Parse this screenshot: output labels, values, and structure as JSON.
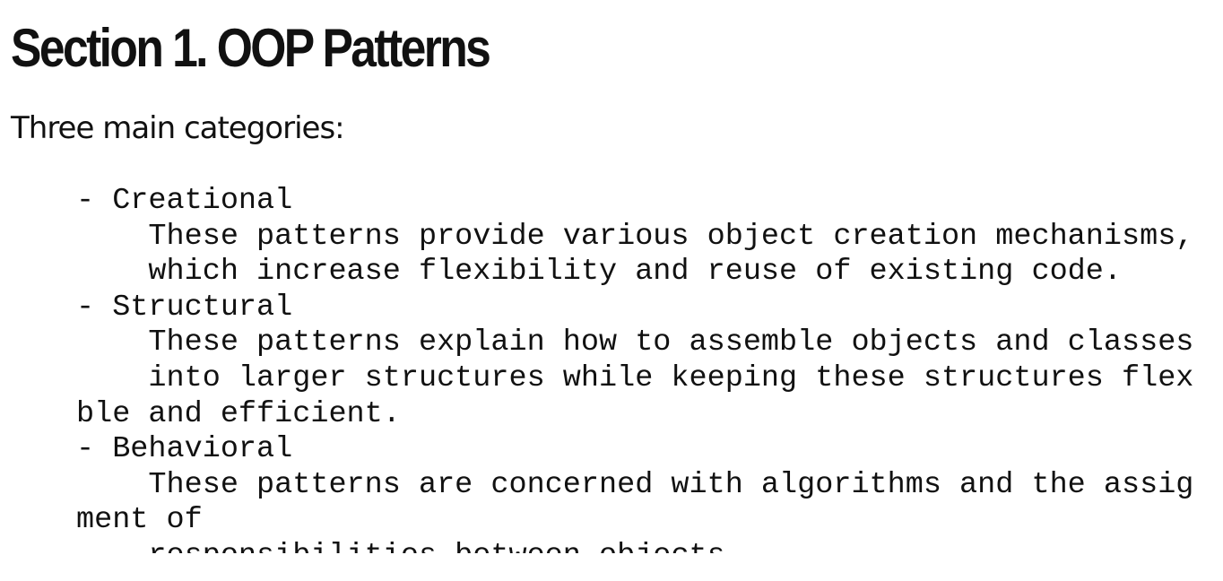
{
  "slide": {
    "title": "Section 1. OOP Patterns",
    "subtitle": "Three main categories:"
  },
  "code_block": {
    "lines": [
      "- Creational",
      "    These patterns provide various object creation mechanisms,",
      "    which increase flexibility and reuse of existing code.",
      "- Structural",
      "    These patterns explain how to assemble objects and classes",
      "    into larger structures while keeping these structures flex",
      "ble and efficient.",
      "- Behavioral",
      "    These patterns are concerned with algorithms and the assig",
      "ment of",
      "    responsibilities between objects."
    ]
  }
}
